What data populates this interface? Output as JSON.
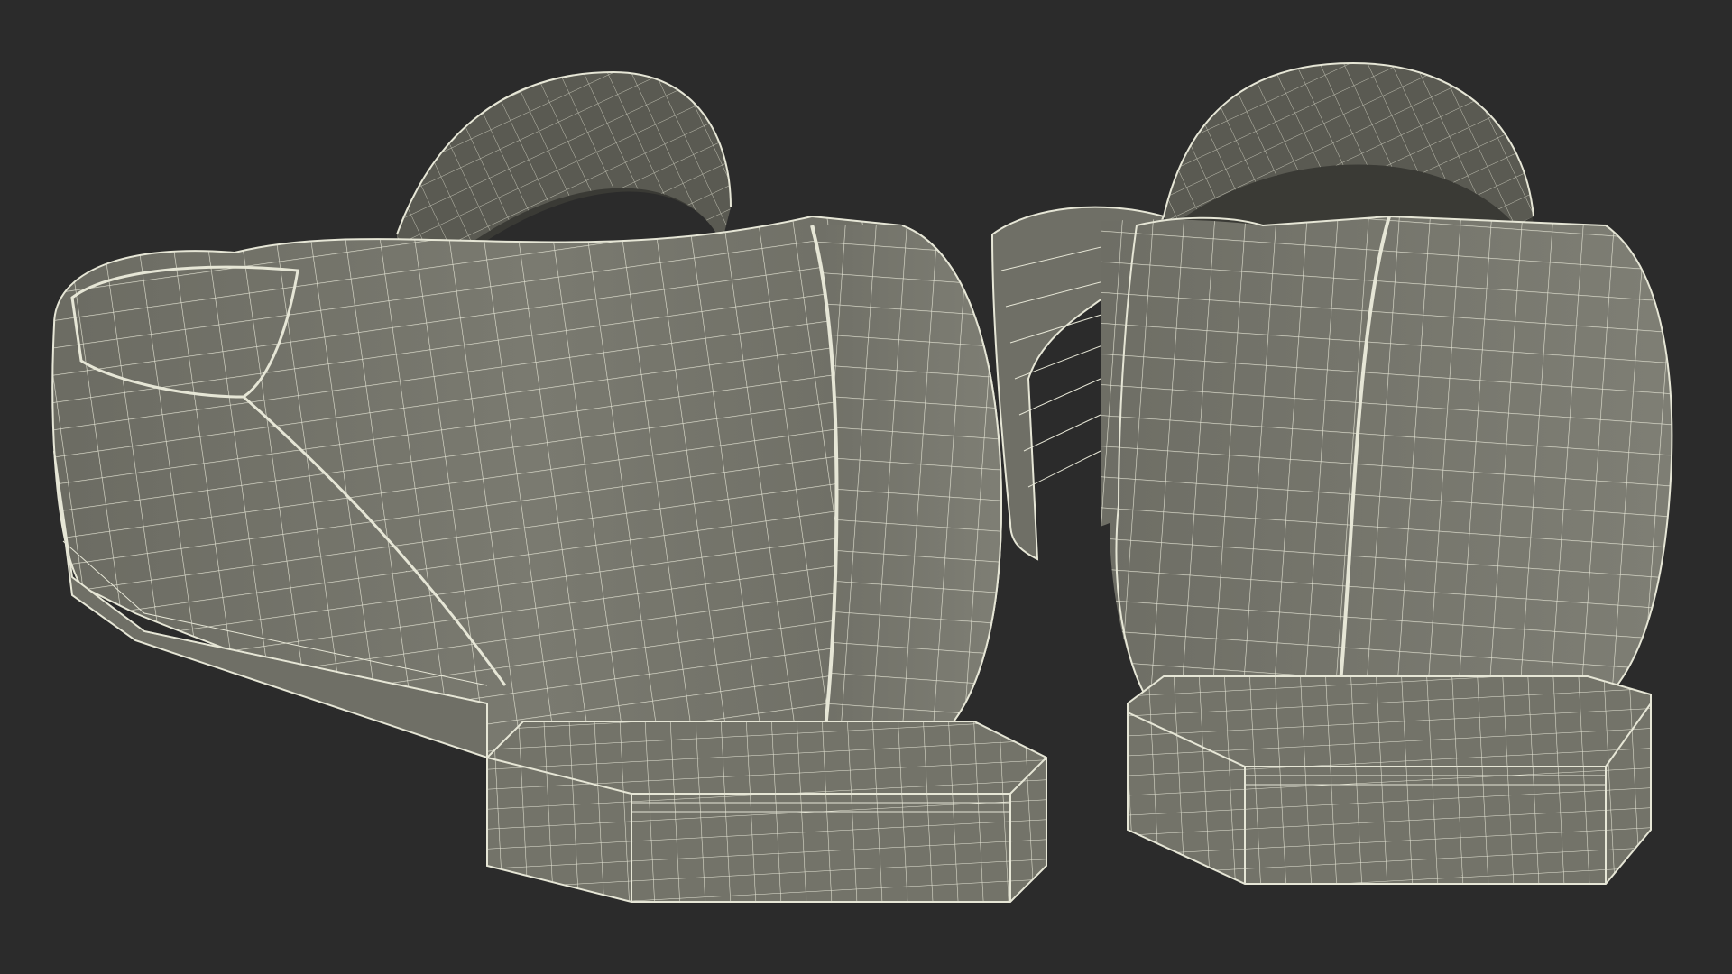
{
  "scene": {
    "subject": "shoes-wireframe",
    "background_color": "#2b2b2b",
    "surface_color": "#76766c",
    "surface_shadow_color": "#5f5f57",
    "interior_color": "#3a3a35",
    "wire_color": "#e6e6d6"
  }
}
